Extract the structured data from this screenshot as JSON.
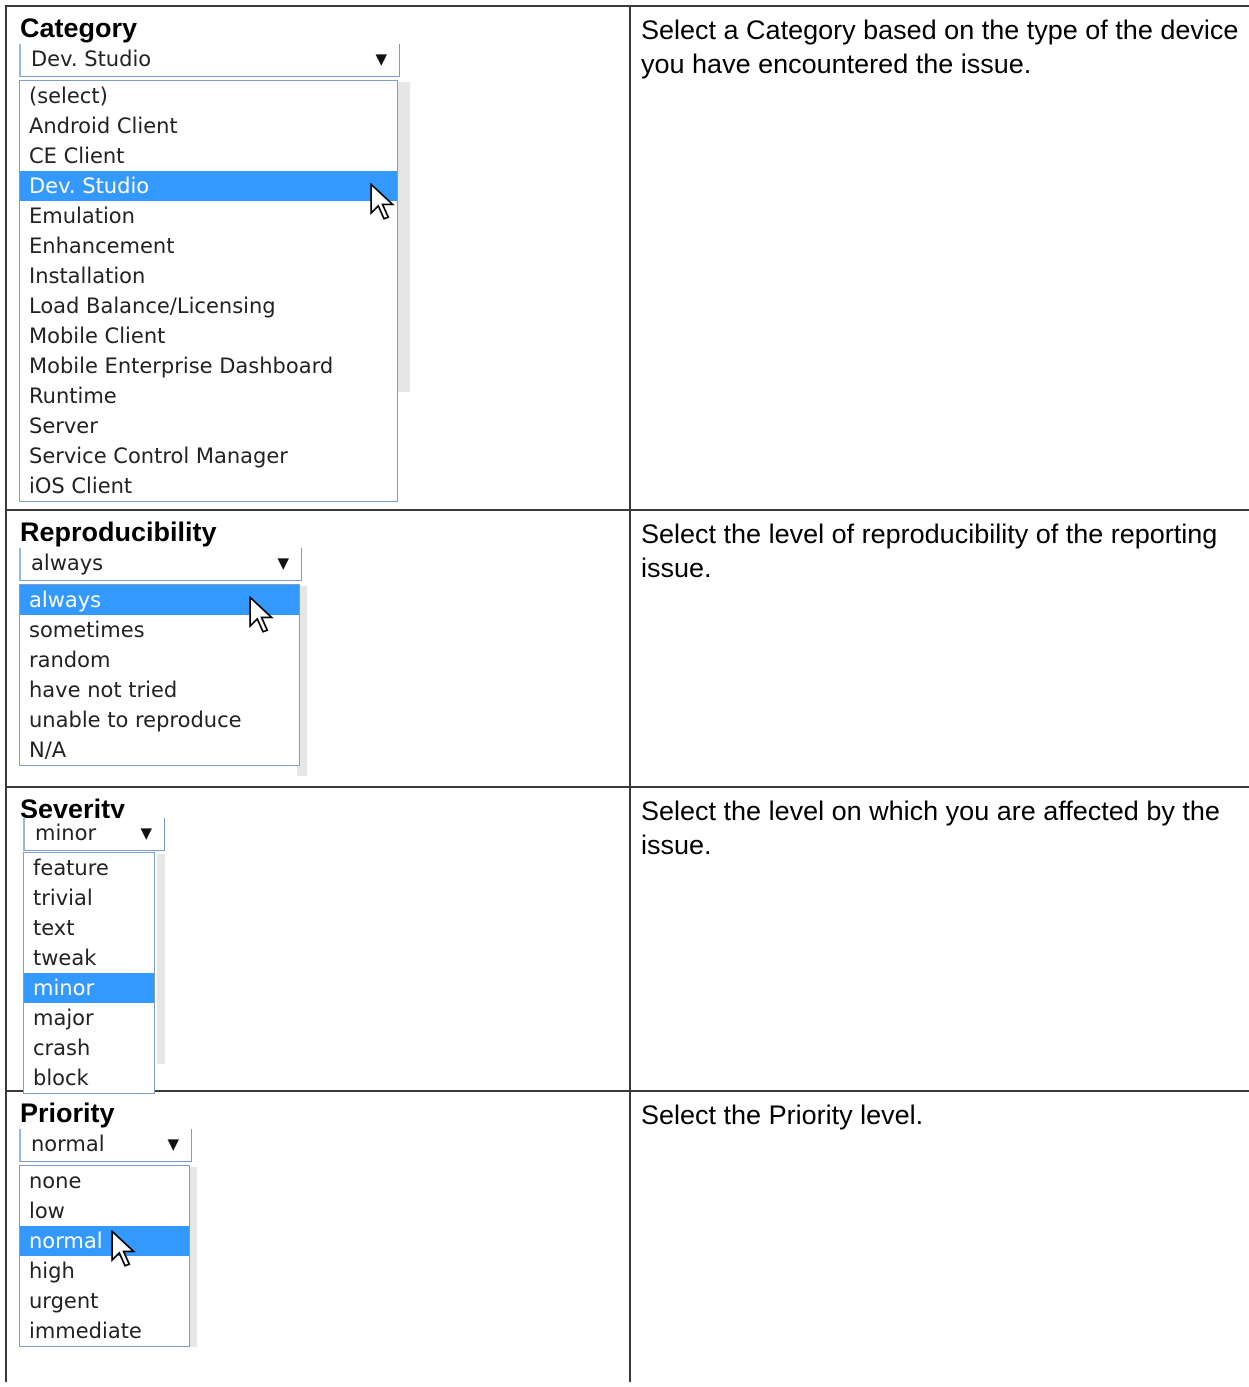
{
  "rows": [
    {
      "label": "Category",
      "selected": "Dev. Studio",
      "options": [
        "(select)",
        "Android Client",
        "CE Client",
        "Dev. Studio",
        "Emulation",
        "Enhancement",
        "Installation",
        "Load Balance/Licensing",
        "Mobile Client",
        "Mobile Enterprise Dashboard",
        "Runtime",
        "Server",
        "Service Control Manager",
        "iOS Client"
      ],
      "description": "Select a Category based on the type of the device you have encountered the issue."
    },
    {
      "label": "Reproducibility",
      "selected": "always",
      "options": [
        "always",
        "sometimes",
        "random",
        "have not tried",
        "unable to reproduce",
        "N/A"
      ],
      "description": "Select the level of reproducibility of the reporting issue."
    },
    {
      "label": "Severity",
      "selected": "minor",
      "options": [
        "feature",
        "trivial",
        "text",
        "tweak",
        "minor",
        "major",
        "crash",
        "block"
      ],
      "description": "Select the level on which you are affected by the issue."
    },
    {
      "label": "Priority",
      "selected": "normal",
      "options": [
        "none",
        "low",
        "normal",
        "high",
        "urgent",
        "immediate"
      ],
      "description": "Select the Priority level."
    }
  ],
  "icons": {
    "dropdown_arrow": "triangle-down-icon",
    "cursor": "mouse-pointer-icon"
  },
  "colors": {
    "highlight": "#3399ff",
    "border": "#3a3a3a"
  }
}
